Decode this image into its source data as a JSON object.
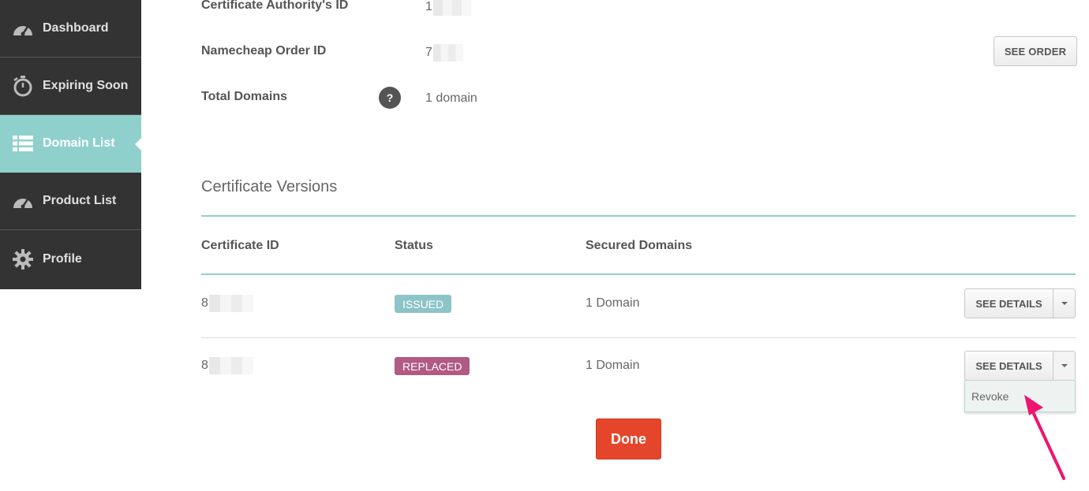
{
  "sidebar": {
    "items": [
      {
        "label": "Dashboard",
        "icon": "gauge-icon"
      },
      {
        "label": "Expiring Soon",
        "icon": "stopwatch-icon"
      },
      {
        "label": "Domain List",
        "icon": "list-icon",
        "active": true
      },
      {
        "label": "Product List",
        "icon": "gauge-icon"
      },
      {
        "label": "Profile",
        "icon": "gear-icon"
      }
    ]
  },
  "details": {
    "ca_id_label": "Certificate Authority's ID",
    "ca_id_value": "1",
    "order_id_label": "Namecheap Order ID",
    "order_id_value": "7",
    "see_order_label": "SEE ORDER",
    "total_domains_label": "Total Domains",
    "help_icon_text": "?",
    "total_domains_value": "1 domain"
  },
  "versions": {
    "title": "Certificate Versions",
    "columns": [
      "Certificate ID",
      "Status",
      "Secured Domains"
    ],
    "rows": [
      {
        "id": "8",
        "status": "ISSUED",
        "domains": "1 Domain",
        "action": "SEE DETAILS"
      },
      {
        "id": "8",
        "status": "REPLACED",
        "domains": "1 Domain",
        "action": "SEE DETAILS"
      }
    ],
    "dropdown_item": "Revoke"
  },
  "done_label": "Done",
  "colors": {
    "sidebar_bg": "#333333",
    "active_bg": "#8fd0cc",
    "teal_line": "#8fd0cc",
    "issued_badge": "#8cc4c7",
    "replaced_badge": "#b05a84",
    "done_button": "#e5462b",
    "annotation_arrow": "#f0146e"
  }
}
